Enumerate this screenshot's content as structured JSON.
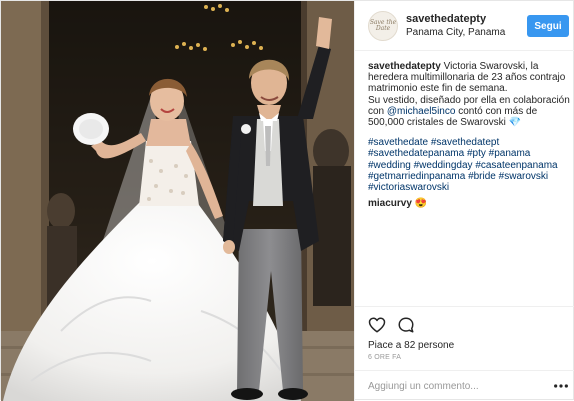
{
  "header": {
    "username": "savethedatepty",
    "location": "Panama City, Panama",
    "follow_label": "Segui",
    "avatar_text": "Save the Date",
    "avatar_icon": "savethedate-logo"
  },
  "caption": {
    "username": "savethedatepty",
    "lines": [
      "Victoria Swarovski, la",
      "heredera multimillonaria de 23 años contrajo",
      "matrimonio este fin de semana.",
      "Su vestido, diseñado por ella en colaboración",
      "con",
      "contó con más de",
      "500,000 cristales de Swarovski 💎"
    ],
    "mention": "@michael5inco",
    "hashtag_lines": [
      [
        "#savethedate",
        "#savethedatept"
      ],
      [
        "#savethedatepanama",
        "#pty",
        "#panama"
      ],
      [
        "#wedding",
        "#weddingday",
        "#casateenpanama"
      ],
      [
        "#getmarriedinpanama",
        "#bride",
        "#swarovski"
      ],
      [
        "#victoriaswarovski"
      ]
    ]
  },
  "comments": [
    {
      "username": "miacurvy",
      "text": "😍"
    }
  ],
  "actions": {
    "like_icon": "heart-icon",
    "comment_icon": "comment-bubble-icon",
    "more_icon": "more-options-icon"
  },
  "likes": {
    "prefix": "Piace a",
    "count": "82",
    "suffix": "persone"
  },
  "timestamp": "6 ORE FA",
  "add_comment": {
    "placeholder": "Aggiungi un commento..."
  },
  "colors": {
    "accent": "#3897f0",
    "link": "#003569",
    "text": "#262626",
    "muted": "#999999",
    "border": "#efefef"
  }
}
